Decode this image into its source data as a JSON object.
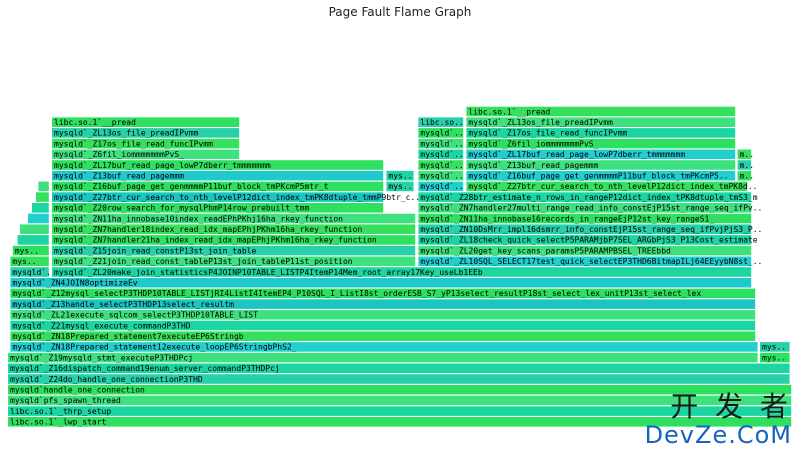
{
  "title": "Page Fault Flame Graph",
  "watermark": {
    "cn": "开 发 者",
    "en": "DevZe.CoM"
  },
  "colors": {
    "c0": "#2ee05f",
    "c1": "#1cd6a2",
    "c2": "#22cfcf",
    "c3": "#3fe07e",
    "c4": "#19c7c0",
    "c5": "#36e05c",
    "c6": "#27d0a8",
    "c7": "#1fc9cc"
  },
  "chart_data": {
    "type": "flamegraph",
    "title": "Page Fault Flame Graph",
    "frames": [
      {
        "depth": 0,
        "start": 0.01,
        "end": 0.99,
        "label": "libc.so.1`_lwp_start",
        "color": "c0"
      },
      {
        "depth": 1,
        "start": 0.01,
        "end": 0.99,
        "label": "libc.so.1`_thrp_setup",
        "color": "c1"
      },
      {
        "depth": 2,
        "start": 0.01,
        "end": 0.99,
        "label": "mysqld`pfs_spawn_thread",
        "color": "c3"
      },
      {
        "depth": 3,
        "start": 0.01,
        "end": 0.99,
        "label": "mysqld`handle_one_connection",
        "color": "c0"
      },
      {
        "depth": 4,
        "start": 0.01,
        "end": 0.988,
        "label": "mysqld`_Z24do_handle_one_connectionP3THD",
        "color": "c6"
      },
      {
        "depth": 5,
        "start": 0.01,
        "end": 0.988,
        "label": "mysqld`_Z16dispatch_command19enum_server_commandP3THDPcj",
        "color": "c1"
      },
      {
        "depth": 6,
        "start": 0.01,
        "end": 0.948,
        "label": "mysqld`_Z19mysqld_stmt_executeP3THDPcj",
        "color": "c3"
      },
      {
        "depth": 6,
        "start": 0.95,
        "end": 0.988,
        "label": "mys..",
        "color": "c0"
      },
      {
        "depth": 7,
        "start": 0.013,
        "end": 0.948,
        "label": "mysqld`_ZN18Prepared_statement12execute_loopEP6StringbPhS2_",
        "color": "c2"
      },
      {
        "depth": 7,
        "start": 0.95,
        "end": 0.988,
        "label": "mys..",
        "color": "c6"
      },
      {
        "depth": 8,
        "start": 0.013,
        "end": 0.945,
        "label": "mysqld`_ZN18Prepared_statement7executeEP6Stringb",
        "color": "c5"
      },
      {
        "depth": 9,
        "start": 0.013,
        "end": 0.945,
        "label": "mysqld`_Z21mysql_execute_commandP3THD",
        "color": "c1"
      },
      {
        "depth": 10,
        "start": 0.013,
        "end": 0.945,
        "label": "mysqld`_ZL21execute_sqlcom_selectP3THDP10TABLE_LIST",
        "color": "c3"
      },
      {
        "depth": 11,
        "start": 0.013,
        "end": 0.945,
        "label": "mysqld`_Z13handle_selectP3THDP13select_resultm",
        "color": "c4"
      },
      {
        "depth": 12,
        "start": 0.013,
        "end": 0.945,
        "label": "mysqld`_Z12mysql_selectP3THDP10TABLE_LISTjRI4ListI4ItemEP4_P10SQL_I_ListI8st_orderESB_S7_yP13select_resultP18st_select_lex_unitP13st_select_lex",
        "color": "c0"
      },
      {
        "depth": 13,
        "start": 0.013,
        "end": 0.94,
        "label": "mysqld`_ZN4JOIN8optimizeEv",
        "color": "c7"
      },
      {
        "depth": 14,
        "start": 0.013,
        "end": 0.062,
        "label": "mysqld`..",
        "color": "c6"
      },
      {
        "depth": 14,
        "start": 0.065,
        "end": 0.94,
        "label": "mysqld`_ZL20make_join_statisticsP4JOINP10TABLE_LISTP4ItemP14Mem_root_array17Key_useLb1EEb",
        "color": "c1"
      },
      {
        "depth": 15,
        "start": 0.013,
        "end": 0.062,
        "label": "mys..",
        "color": "c5"
      },
      {
        "depth": 15,
        "start": 0.065,
        "end": 0.52,
        "label": "mysqld`_Z21join_read_const_tableP13st_join_tableP11st_position",
        "color": "c3"
      },
      {
        "depth": 15,
        "start": 0.523,
        "end": 0.94,
        "label": "mysqld`_ZL10SQL_SELECT17test_quick_selectEP3THD6BitmapILj64EEyybN8st_..",
        "color": "c2"
      },
      {
        "depth": 16,
        "start": 0.016,
        "end": 0.062,
        "label": "mys..",
        "color": "c0"
      },
      {
        "depth": 16,
        "start": 0.065,
        "end": 0.52,
        "label": "mysqld`_Z15join_read_constP13st_join_table",
        "color": "c6"
      },
      {
        "depth": 16,
        "start": 0.523,
        "end": 0.94,
        "label": "mysqld`_ZL20get_key_scans_paramsP5PARAMPBSEL_TREEbbd",
        "color": "c3"
      },
      {
        "depth": 17,
        "start": 0.022,
        "end": 0.062,
        "label": "",
        "color": "c1"
      },
      {
        "depth": 17,
        "start": 0.065,
        "end": 0.52,
        "label": "mysqld`_ZN7handler21ha_index_read_idx_mapEPhjPKhm16ha_rkey_function",
        "color": "c0"
      },
      {
        "depth": 17,
        "start": 0.523,
        "end": 0.94,
        "label": "mysqld`_ZL18check_quick_selectP5PARAMjbP7SEL_ARGbPjS3_P13Cost_estimate",
        "color": "c1"
      },
      {
        "depth": 18,
        "start": 0.025,
        "end": 0.062,
        "label": "",
        "color": "c3"
      },
      {
        "depth": 18,
        "start": 0.065,
        "end": 0.52,
        "label": "mysqld`_ZN7handler18index_read_idx_mapEPhjPKhm16ha_rkey_function",
        "color": "c5"
      },
      {
        "depth": 18,
        "start": 0.523,
        "end": 0.94,
        "label": "mysqld`_ZN10DsMrr_impl16dsmrr_info_constEjP15st_range_seq_ifPvjPjS3_P..",
        "color": "c6"
      },
      {
        "depth": 19,
        "start": 0.035,
        "end": 0.062,
        "label": "",
        "color": "c2"
      },
      {
        "depth": 19,
        "start": 0.065,
        "end": 0.52,
        "label": "mysqld`_ZN11ha_innobase10index_readEPhPKhj16ha_rkey_function",
        "color": "c3"
      },
      {
        "depth": 19,
        "start": 0.523,
        "end": 0.94,
        "label": "mysqld`_ZN11ha_innobase16records_in_rangeEjP12st_key_rangeS1_",
        "color": "c0"
      },
      {
        "depth": 20,
        "start": 0.04,
        "end": 0.062,
        "label": "",
        "color": "c1"
      },
      {
        "depth": 20,
        "start": 0.065,
        "end": 0.48,
        "label": "mysqld`_Z20row_search_for_mysqlPhmP14row_prebuilt_tmm",
        "color": "c0"
      },
      {
        "depth": 20,
        "start": 0.523,
        "end": 0.94,
        "label": "mysqld`_ZN7handler27multi_range_read_info_constEjP15st_range_seq_ifPv..",
        "color": "c3"
      },
      {
        "depth": 21,
        "start": 0.045,
        "end": 0.062,
        "label": "",
        "color": "c5"
      },
      {
        "depth": 21,
        "start": 0.065,
        "end": 0.48,
        "label": "mysqld`_Z27btr_cur_search_to_nth_levelP12dict_index_tmPK8dtuple_tmmP9btr_c..",
        "color": "c4"
      },
      {
        "depth": 21,
        "start": 0.523,
        "end": 0.94,
        "label": "mysqld`_Z28btr_estimate_n_rows_in_rangeP12dict_index_tPK8dtuple_tmS3_m",
        "color": "c1"
      },
      {
        "depth": 22,
        "start": 0.048,
        "end": 0.062,
        "label": "",
        "color": "c3"
      },
      {
        "depth": 22,
        "start": 0.065,
        "end": 0.48,
        "label": "mysqld`_Z16buf_page_get_genmmmmP11buf_block_tmPKcmP5mtr_t",
        "color": "c0"
      },
      {
        "depth": 22,
        "start": 0.483,
        "end": 0.518,
        "label": "mys..",
        "color": "c6"
      },
      {
        "depth": 22,
        "start": 0.523,
        "end": 0.58,
        "label": "mysqld`..",
        "color": "c2"
      },
      {
        "depth": 22,
        "start": 0.583,
        "end": 0.935,
        "label": "mysqld`_Z27btr_cur_search_to_nth_levelP12dict_index_tmPK8d..",
        "color": "c5"
      },
      {
        "depth": 23,
        "start": 0.065,
        "end": 0.48,
        "label": "mysqld`_Z13buf_read_pagemmm",
        "color": "c7"
      },
      {
        "depth": 23,
        "start": 0.483,
        "end": 0.518,
        "label": "mys..",
        "color": "c1"
      },
      {
        "depth": 23,
        "start": 0.523,
        "end": 0.58,
        "label": "mysqld`..",
        "color": "c3"
      },
      {
        "depth": 23,
        "start": 0.583,
        "end": 0.92,
        "label": "mysqld`_Z16buf_page_get_genmmmmP11buf_block_tmPKcmP5..",
        "color": "c2"
      },
      {
        "depth": 23,
        "start": 0.922,
        "end": 0.94,
        "label": "m..",
        "color": "c0"
      },
      {
        "depth": 24,
        "start": 0.065,
        "end": 0.48,
        "label": "mysqld`_ZL17buf_read_page_lowP7dberr_tmmmmmmm",
        "color": "c0"
      },
      {
        "depth": 24,
        "start": 0.523,
        "end": 0.58,
        "label": "mysqld`..",
        "color": "c5"
      },
      {
        "depth": 24,
        "start": 0.583,
        "end": 0.92,
        "label": "mysqld`_Z13buf_read_pagemmm",
        "color": "c3"
      },
      {
        "depth": 24,
        "start": 0.922,
        "end": 0.94,
        "label": "m..",
        "color": "c6"
      },
      {
        "depth": 25,
        "start": 0.065,
        "end": 0.3,
        "label": "mysqld`_Z6fil_iommmmmmmPvS_",
        "color": "c3"
      },
      {
        "depth": 25,
        "start": 0.523,
        "end": 0.58,
        "label": "mysqld`..",
        "color": "c1"
      },
      {
        "depth": 25,
        "start": 0.583,
        "end": 0.92,
        "label": "mysqld`_ZL17buf_read_page_lowP7dberr_tmmmmmmm",
        "color": "c2"
      },
      {
        "depth": 25,
        "start": 0.922,
        "end": 0.94,
        "label": "m..",
        "color": "c5"
      },
      {
        "depth": 26,
        "start": 0.065,
        "end": 0.3,
        "label": "mysqld`_Z17os_file_read_funcIPvmm",
        "color": "c5"
      },
      {
        "depth": 26,
        "start": 0.523,
        "end": 0.58,
        "label": "mysqld`..",
        "color": "c3"
      },
      {
        "depth": 26,
        "start": 0.583,
        "end": 0.92,
        "label": "mysqld`_Z6fil_iommmmmmmPvS_",
        "color": "c0"
      },
      {
        "depth": 27,
        "start": 0.065,
        "end": 0.3,
        "label": "mysqld`_ZL13os_file_preadIPvmm",
        "color": "c6"
      },
      {
        "depth": 27,
        "start": 0.523,
        "end": 0.58,
        "label": "mysqld`..",
        "color": "c0"
      },
      {
        "depth": 27,
        "start": 0.583,
        "end": 0.92,
        "label": "mysqld`_Z17os_file_read_funcIPvmm",
        "color": "c1"
      },
      {
        "depth": 28,
        "start": 0.065,
        "end": 0.3,
        "label": "libc.so.1`__pread",
        "color": "c0"
      },
      {
        "depth": 28,
        "start": 0.523,
        "end": 0.58,
        "label": "libc.so..",
        "color": "c6"
      },
      {
        "depth": 28,
        "start": 0.583,
        "end": 0.92,
        "label": "mysqld`_ZL13os_file_preadIPvmm",
        "color": "c3"
      },
      {
        "depth": 29,
        "start": 0.583,
        "end": 0.92,
        "label": "libc.so.1`__pread",
        "color": "c5"
      }
    ]
  }
}
